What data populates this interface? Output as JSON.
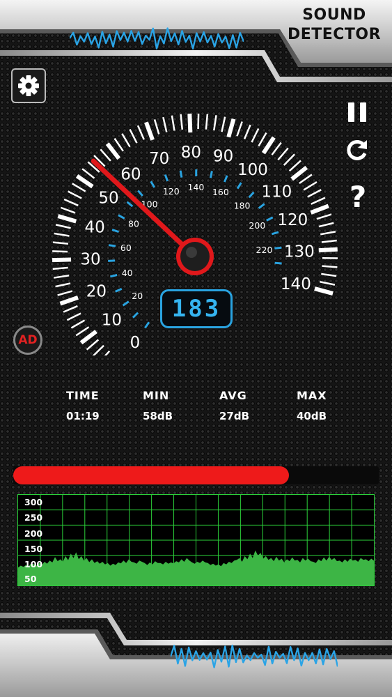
{
  "app": {
    "title_line1": "SOUND",
    "title_line2": "DETECTOR"
  },
  "toolbar": {
    "settings_icon": "gear-icon",
    "pause_icon": "pause-icon",
    "refresh_icon": "refresh-icon",
    "help_icon": "question-mark-icon",
    "help_label": "?"
  },
  "ad_badge": {
    "label": "AD"
  },
  "gauge": {
    "outer_labels": [
      "0",
      "10",
      "20",
      "30",
      "40",
      "50",
      "60",
      "70",
      "80",
      "90",
      "100",
      "110",
      "120",
      "130",
      "140"
    ],
    "inner_labels": [
      "20",
      "40",
      "60",
      "80",
      "100",
      "120",
      "140",
      "160",
      "180",
      "200",
      "220"
    ],
    "needle_value": 55,
    "max_value": 140,
    "digital_readout": "183",
    "colors": {
      "needle": "#e0181b",
      "accent": "#29a3e0",
      "ticks": "#ffffff"
    }
  },
  "stats": {
    "time": {
      "label": "TIME",
      "value": "01:19"
    },
    "min": {
      "label": "MIN",
      "value": "58dB"
    },
    "avg": {
      "label": "AVG",
      "value": "27dB"
    },
    "max": {
      "label": "MAX",
      "value": "40dB"
    }
  },
  "level_bar": {
    "fraction": 0.755,
    "color": "#ee1a1a"
  },
  "history_graph": {
    "y_labels": [
      "300",
      "250",
      "200",
      "150",
      "100",
      "50"
    ],
    "y_range": [
      25,
      312
    ],
    "grid_color": "#2bd13a",
    "fill_color": "#3db545",
    "samples": [
      82,
      88,
      84,
      90,
      86,
      95,
      92,
      88,
      96,
      90,
      100,
      94,
      104,
      98,
      115,
      102,
      108,
      100,
      118,
      105,
      126,
      112,
      130,
      108,
      118,
      104,
      112,
      99,
      108,
      96,
      102,
      94,
      100,
      92,
      96,
      88,
      94,
      90,
      98,
      95,
      104,
      96,
      108,
      100,
      98,
      94,
      104,
      100,
      96,
      90,
      98,
      92,
      102,
      96,
      96,
      92,
      100,
      94,
      98,
      95,
      102,
      98,
      108,
      100,
      112,
      104,
      98,
      94,
      100,
      96,
      104,
      98,
      96,
      90,
      94,
      88,
      92,
      86,
      96,
      92,
      100,
      96,
      104,
      106,
      112,
      100,
      118,
      108,
      126,
      112,
      136,
      120,
      128,
      110,
      118,
      106,
      112,
      102,
      116,
      104,
      110,
      98,
      108,
      102,
      114,
      104,
      106,
      98,
      112,
      104,
      110,
      102,
      100,
      96,
      108,
      102,
      114,
      104,
      116,
      106,
      112,
      102,
      104,
      98,
      108,
      100,
      110,
      104,
      106,
      100,
      112,
      106,
      108,
      102,
      110,
      104
    ]
  }
}
